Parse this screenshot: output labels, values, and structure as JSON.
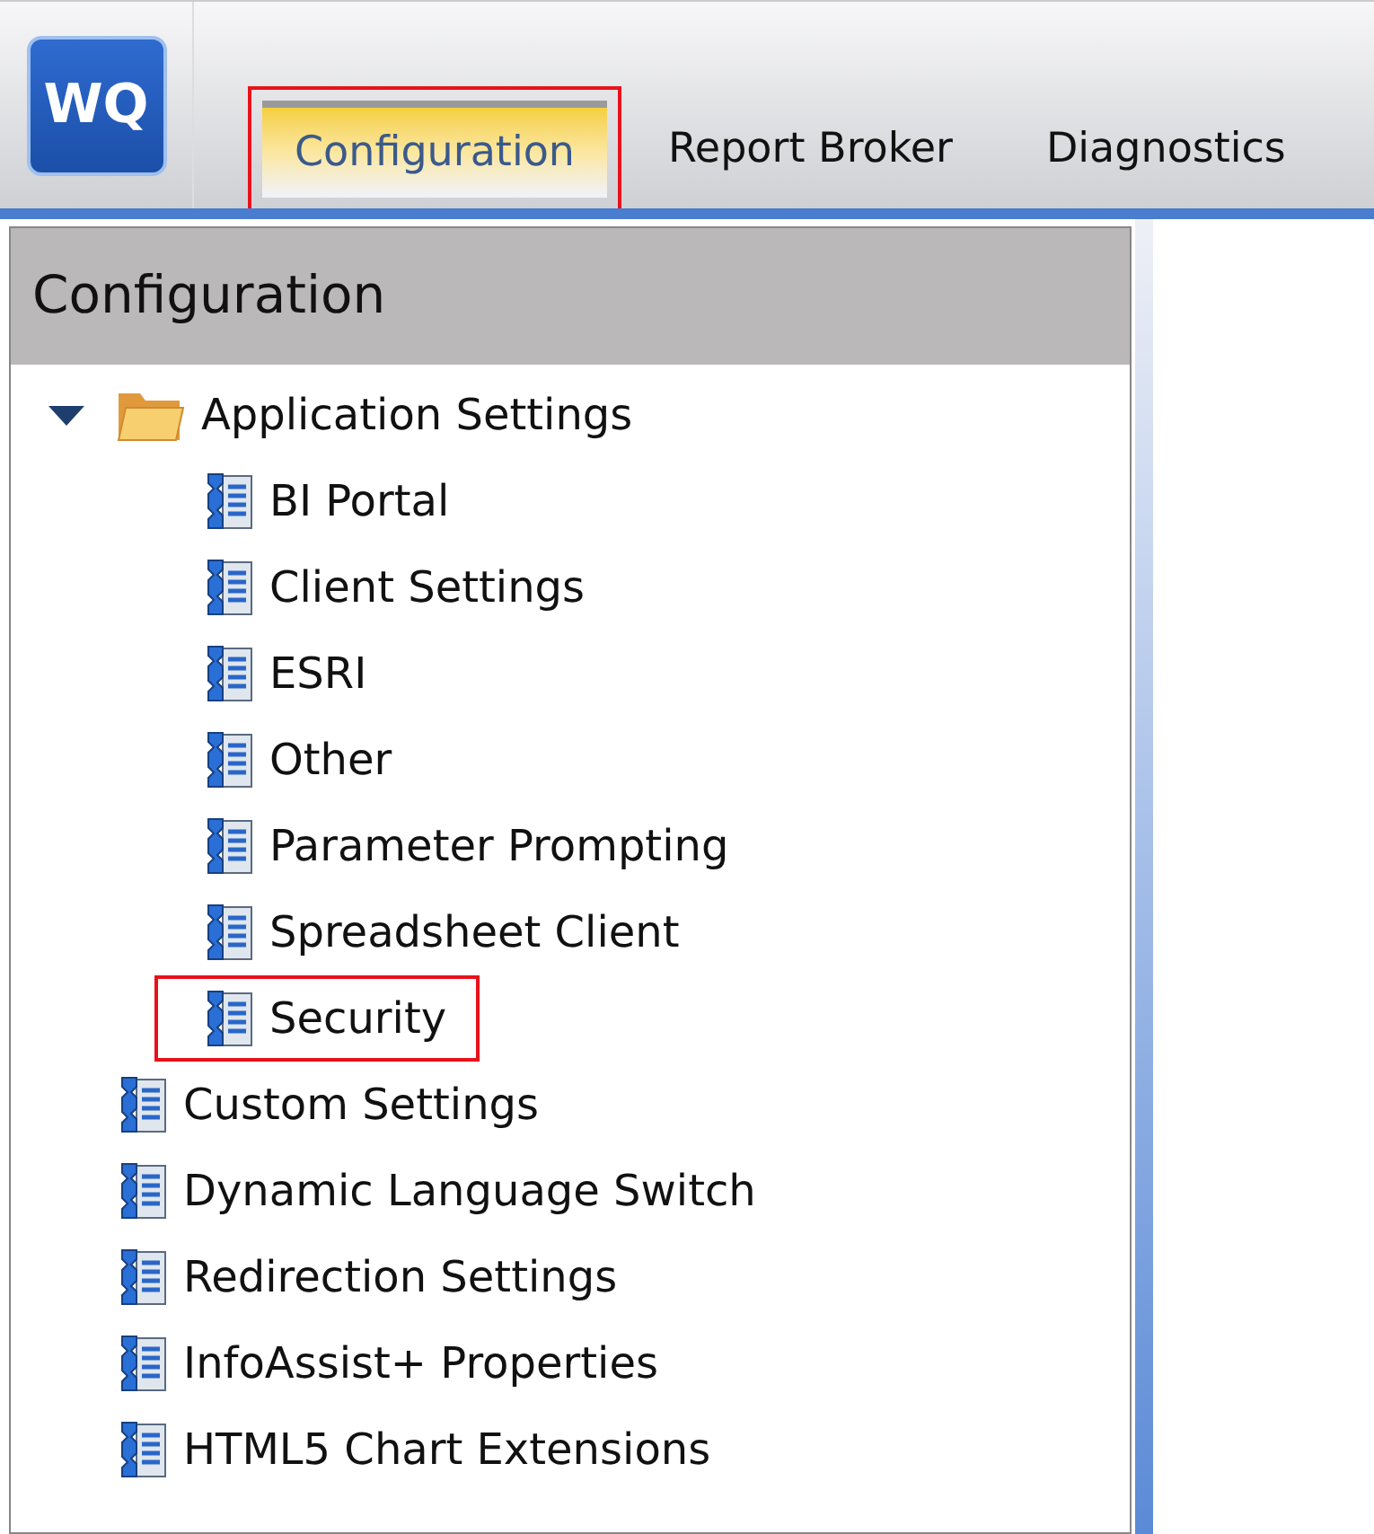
{
  "logo": "WQ",
  "tabs": [
    {
      "label": "Configuration",
      "selected": true,
      "highlighted": true
    },
    {
      "label": "Report Broker",
      "selected": false,
      "highlighted": false
    },
    {
      "label": "Diagnostics",
      "selected": false,
      "highlighted": false
    }
  ],
  "panel": {
    "title": "Configuration"
  },
  "tree": [
    {
      "label": "Application Settings",
      "kind": "folder",
      "expanded": true,
      "highlighted": false,
      "children": [
        {
          "label": "BI Portal",
          "kind": "settings",
          "highlighted": false
        },
        {
          "label": "Client Settings",
          "kind": "settings",
          "highlighted": false
        },
        {
          "label": "ESRI",
          "kind": "settings",
          "highlighted": false
        },
        {
          "label": "Other",
          "kind": "settings",
          "highlighted": false
        },
        {
          "label": "Parameter Prompting",
          "kind": "settings",
          "highlighted": false
        },
        {
          "label": "Spreadsheet Client",
          "kind": "settings",
          "highlighted": false
        },
        {
          "label": "Security",
          "kind": "settings",
          "highlighted": true
        }
      ]
    },
    {
      "label": "Custom Settings",
      "kind": "settings",
      "highlighted": false
    },
    {
      "label": "Dynamic Language Switch",
      "kind": "settings",
      "highlighted": false
    },
    {
      "label": "Redirection Settings",
      "kind": "settings",
      "highlighted": false
    },
    {
      "label": "InfoAssist+ Properties",
      "kind": "settings",
      "highlighted": false
    },
    {
      "label": "HTML5 Chart Extensions",
      "kind": "settings",
      "highlighted": false
    }
  ]
}
